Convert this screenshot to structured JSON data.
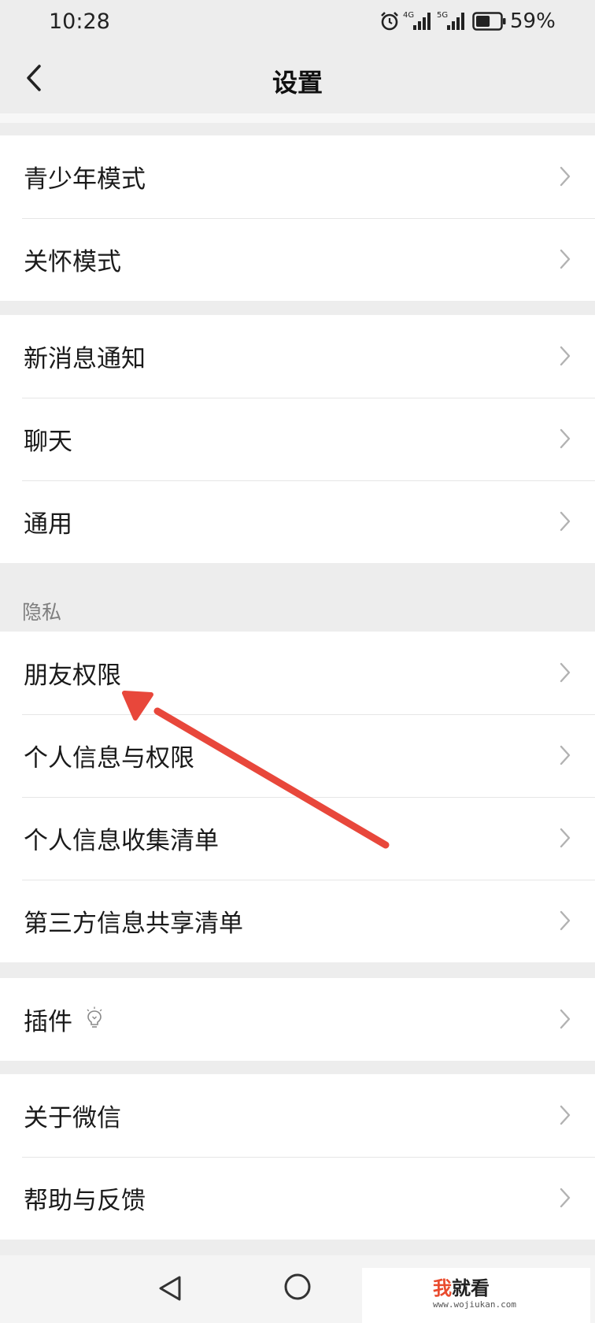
{
  "status_bar": {
    "time": "10:28",
    "net1": "4G",
    "net2": "5G",
    "battery": "59%"
  },
  "header": {
    "title": "设置"
  },
  "groups": [
    {
      "items": [
        {
          "label": "青少年模式"
        },
        {
          "label": "关怀模式"
        }
      ]
    },
    {
      "items": [
        {
          "label": "新消息通知"
        },
        {
          "label": "聊天"
        },
        {
          "label": "通用"
        }
      ]
    },
    {
      "section_label": "隐私",
      "items": [
        {
          "label": "朋友权限"
        },
        {
          "label": "个人信息与权限"
        },
        {
          "label": "个人信息收集清单"
        },
        {
          "label": "第三方信息共享清单"
        }
      ]
    },
    {
      "items": [
        {
          "label": "插件"
        }
      ]
    },
    {
      "items": [
        {
          "label": "关于微信"
        },
        {
          "label": "帮助与反馈"
        }
      ]
    }
  ],
  "watermark": {
    "accent": "我",
    "main": "就看",
    "sub": "www.wojiukan.com"
  },
  "colors": {
    "background": "#ededed",
    "annotation_arrow": "#e8473b",
    "watermark_accent": "#e94b2e"
  }
}
